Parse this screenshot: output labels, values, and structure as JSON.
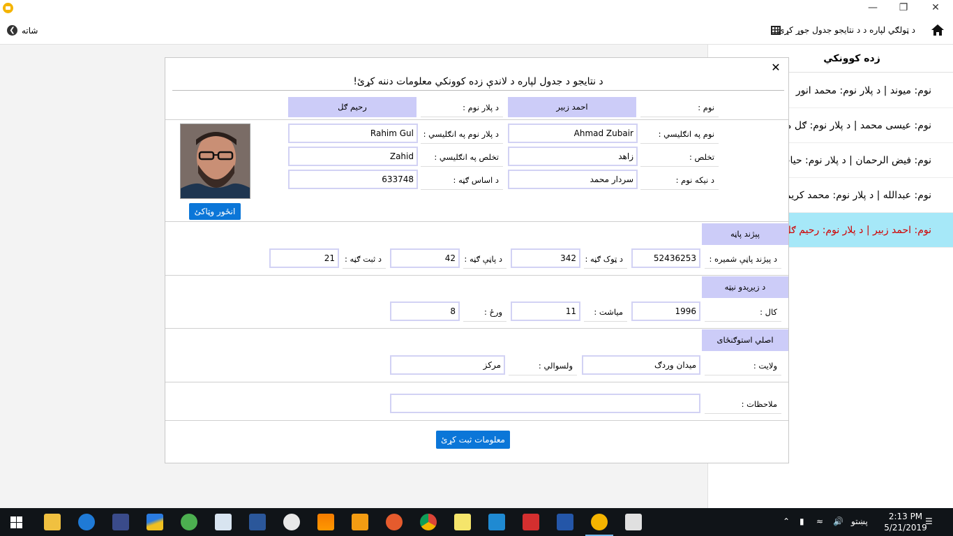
{
  "window": {
    "minimize_glyph": "—",
    "maximize_glyph": "❐",
    "close_glyph": "✕"
  },
  "header": {
    "back_label": "شاته",
    "back_icon": "arrow-left-circle-icon",
    "page_title": "د ټولګي لپاره د د نتایجو جدول جوړ کړئ",
    "table_icon": "table-grid-icon",
    "home_icon": "home-icon"
  },
  "sidebar": {
    "title": "زده کوونکي",
    "items": [
      {
        "text": "نوم: میوند  |  د پلار نوم: محمد انور"
      },
      {
        "text": "نوم: عیسی محمد  |  د پلار نوم: ګل محمد"
      },
      {
        "text": "نوم: فیض الرحمان  |  د پلار نوم: حیات الله"
      },
      {
        "text": "نوم: عبدالله  |  د پلار نوم: محمد کریم"
      },
      {
        "text": "نوم: احمد زبیر  |  د پلار نوم: رحیم ګل"
      }
    ]
  },
  "form": {
    "close_glyph": "✕",
    "title": "د نتایجو د جدول لپاره د لاندې زده کوونکي معلومات دننه کړئ!",
    "name_label": "نوم  :",
    "name_value": "احمد زبیر",
    "father_label": "د پلار نوم :",
    "father_value": "رحیم ګل",
    "name_en_label": "نوم په انګلیسي :",
    "name_en_value": "Ahmad Zubair",
    "father_en_label": "د پلار نوم په انګلیسي :",
    "father_en_value": "Rahim Gul",
    "pen_label": "تخلص :",
    "pen_value": "زاهد",
    "pen_en_label": "تخلص په انګلیسي :",
    "pen_en_value": "Zahid",
    "grandfather_label": "د نیکه نوم :",
    "grandfather_value": "سردار محمد",
    "base_no_label": "د اساس ګڼه :",
    "base_no_value": "633748",
    "change_photo_button": "انځور وټاکئ",
    "id_section_tag": "پېژند پاڼه",
    "id_no_label": "د پیژند پاڼې شمیره :",
    "id_no_value": "52436253",
    "volume_label": "د ټوک ګڼه :",
    "volume_value": "342",
    "page_label": "د پاڼې ګڼه :",
    "page_value": "42",
    "record_label": "د ثبت ګڼه :",
    "record_value": "21",
    "birth_section_tag": "د زیږیدو نیټه",
    "year_label": "کال :",
    "year_value": "1996",
    "month_label": "میاشت :",
    "month_value": "11",
    "day_label": "ورځ :",
    "day_value": "8",
    "residence_section_tag": "اصلي استوګنځای",
    "province_label": "ولایت :",
    "province_value": "میدان وردګ",
    "district_label": "ولسوالي :",
    "district_value": "مرکز",
    "notes_label": "ملاحظات :",
    "notes_value": "",
    "submit_button": "معلومات ثبت کړئ"
  },
  "taskbar": {
    "time": "2:13 PM",
    "date": "5/21/2019",
    "language": "پښتو",
    "apps": [
      "file-explorer-icon",
      "edge-icon",
      "ship-app-icon",
      "stripes-app-icon",
      "green-swirl-app-icon",
      "notepad-app-icon",
      "word-icon",
      "paint-app-icon",
      "vlc-icon",
      "sublime-text-icon",
      "firefox-icon",
      "chrome-icon",
      "sticky-notes-icon",
      "vscode-icon",
      "pdf-reader-icon",
      "powershell-icon",
      "yellow-app-icon",
      "java-app-icon"
    ]
  },
  "colors": {
    "accent_button": "#0b76d8",
    "chip_background": "#ccccf8",
    "selected_row": "#a6e8f8",
    "selected_text": "#d00000"
  }
}
